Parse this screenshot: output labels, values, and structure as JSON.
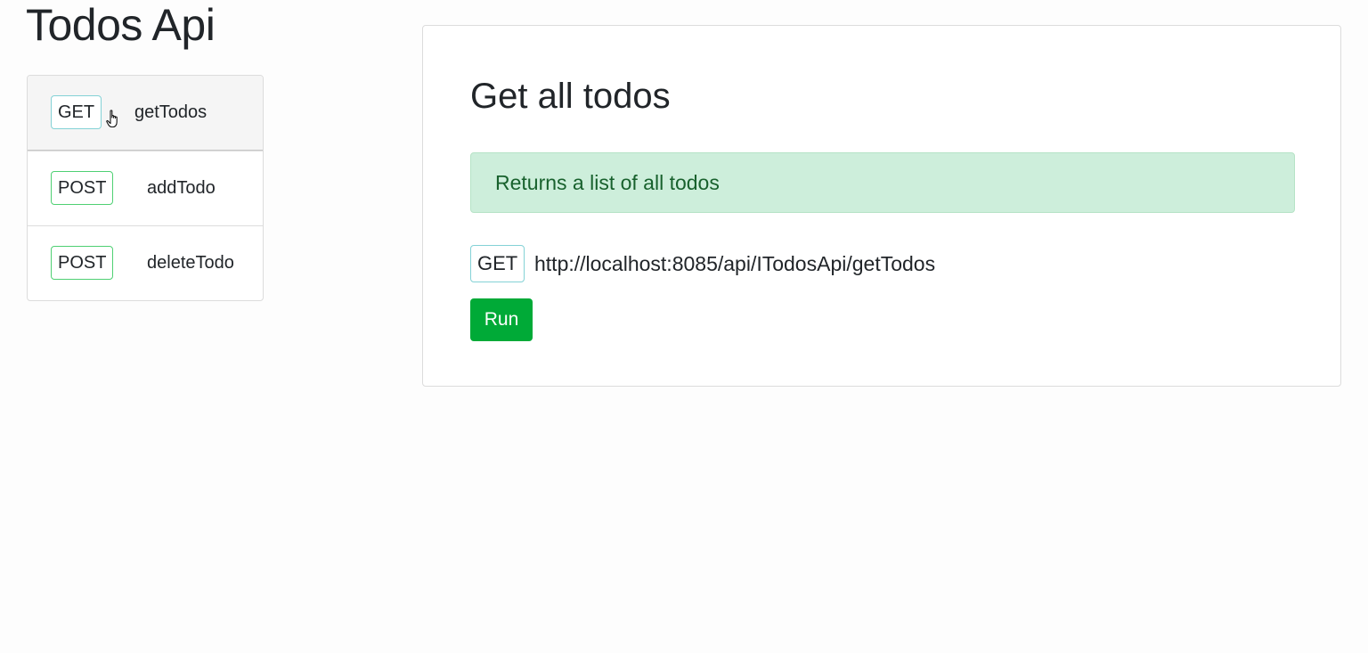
{
  "app": {
    "title": "Todos Api"
  },
  "endpoints": [
    {
      "method": "GET",
      "name": "getTodos"
    },
    {
      "method": "POST",
      "name": "addTodo"
    },
    {
      "method": "POST",
      "name": "deleteTodo"
    }
  ],
  "detail": {
    "title": "Get all todos",
    "description": "Returns a list of all todos",
    "method": "GET",
    "url": "http://localhost:8085/api/ITodosApi/getTodos",
    "run_label": "Run"
  },
  "colors": {
    "get_badge_border": "#84d2d6",
    "post_badge_border": "#4fd073",
    "run_button": "#00aa37",
    "alert_background": "#cdeedb",
    "alert_text": "#18612d"
  },
  "icons": {
    "cursor": "hand-pointer-icon"
  }
}
